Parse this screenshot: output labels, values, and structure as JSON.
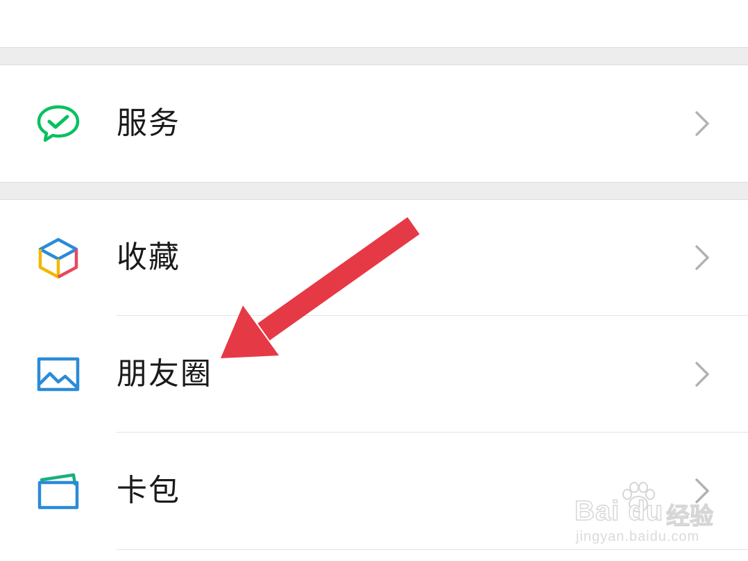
{
  "menu": {
    "items": [
      {
        "label": "服务",
        "icon": "wechat-pay-icon"
      },
      {
        "label": "收藏",
        "icon": "favorites-cube-icon"
      },
      {
        "label": "朋友圈",
        "icon": "moments-picture-icon"
      },
      {
        "label": "卡包",
        "icon": "card-wallet-icon"
      }
    ],
    "chevron_icon": "chevron-right-icon"
  },
  "annotation": {
    "arrow_icon": "red-pointer-arrow-icon",
    "arrow_color": "#e63946"
  },
  "watermark": {
    "brand": "Bai du",
    "brand_cn": "经验",
    "url": "jingyan.baidu.com"
  },
  "colors": {
    "background": "#ffffff",
    "separator_band": "#ededed",
    "text": "#1a1a1a",
    "chevron": "#b2b2b2",
    "wechat_green": "#07c160",
    "moments_blue": "#2a8bd8"
  }
}
